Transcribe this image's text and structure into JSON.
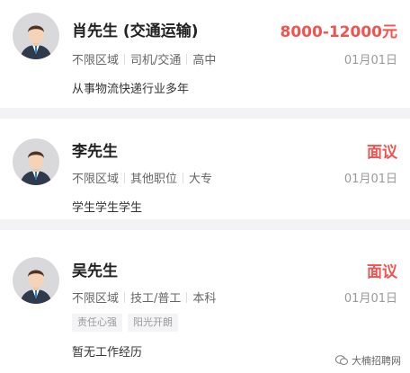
{
  "candidates": [
    {
      "name": "肖先生",
      "position": "(交通运输)",
      "salary": "8000-12000元",
      "meta": [
        "不限区域",
        "司机/交通",
        "高中"
      ],
      "date": "01月01日",
      "desc": "从事物流快递行业多年",
      "tags": []
    },
    {
      "name": "李先生",
      "position": "",
      "salary": "面议",
      "meta": [
        "不限区域",
        "其他职位",
        "大专"
      ],
      "date": "01月01日",
      "desc": "学生学生学生",
      "tags": []
    },
    {
      "name": "吴先生",
      "position": "",
      "salary": "面议",
      "meta": [
        "不限区域",
        "技工/普工",
        "本科"
      ],
      "date": "01月01日",
      "desc": "暂无工作经历",
      "tags": [
        "责任心强",
        "阳光开朗"
      ]
    }
  ],
  "watermark": "大楠招聘网",
  "colors": {
    "salary": "#f2534e",
    "background": "#f3f3f5"
  }
}
